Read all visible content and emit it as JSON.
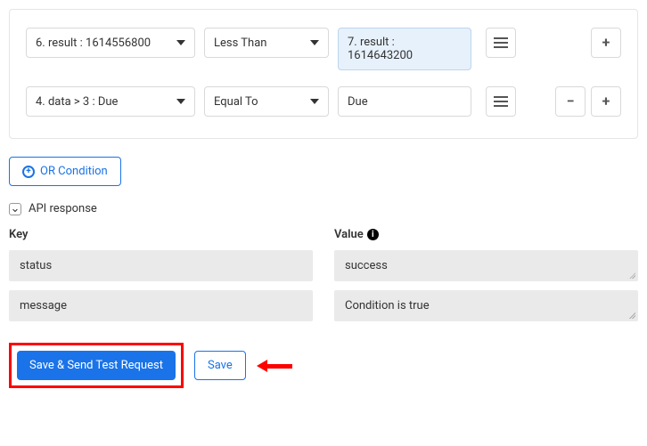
{
  "conditions": [
    {
      "lhs": "6. result : 1614556800",
      "op": "Less Than",
      "rhs": "7. result : 1614643200",
      "rhs_is_token": true,
      "show_minus": false
    },
    {
      "lhs": "4. data > 3 : Due",
      "op": "Equal To",
      "rhs": "Due",
      "rhs_is_token": false,
      "show_minus": true
    }
  ],
  "or_condition_label": "OR Condition",
  "api_response_label": "API response",
  "columns": {
    "key_label": "Key",
    "value_label": "Value"
  },
  "api_rows": [
    {
      "key": "status",
      "value": "success"
    },
    {
      "key": "message",
      "value": "Condition is true"
    }
  ],
  "buttons": {
    "save_send": "Save & Send Test Request",
    "save": "Save"
  }
}
